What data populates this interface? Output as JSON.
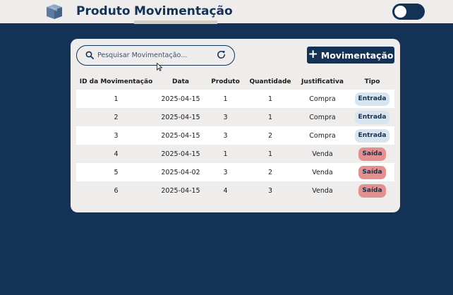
{
  "nav": {
    "items": [
      {
        "label": "Produto"
      },
      {
        "label": "Movimentação"
      }
    ],
    "active": "Movimentação"
  },
  "search": {
    "placeholder": "Pesquisar Movimentação...",
    "value": ""
  },
  "toolbar": {
    "add_label": "Movimentação",
    "add_icon": "plus-icon"
  },
  "table": {
    "columns": [
      "ID da Movimentação",
      "Data",
      "Produto",
      "Quantidade",
      "Justificativa",
      "Tipo"
    ],
    "rows": [
      {
        "id": "1",
        "data": "2025-04-15",
        "produto": "1",
        "quantidade": "1",
        "justificativa": "Compra",
        "tipo": "Entrada"
      },
      {
        "id": "2",
        "data": "2025-04-15",
        "produto": "3",
        "quantidade": "1",
        "justificativa": "Compra",
        "tipo": "Entrada"
      },
      {
        "id": "3",
        "data": "2025-04-15",
        "produto": "3",
        "quantidade": "2",
        "justificativa": "Compra",
        "tipo": "Entrada"
      },
      {
        "id": "4",
        "data": "2025-04-15",
        "produto": "1",
        "quantidade": "1",
        "justificativa": "Venda",
        "tipo": "Saída"
      },
      {
        "id": "5",
        "data": "2025-04-02",
        "produto": "3",
        "quantidade": "2",
        "justificativa": "Venda",
        "tipo": "Saída"
      },
      {
        "id": "6",
        "data": "2025-04-15",
        "produto": "4",
        "quantidade": "3",
        "justificativa": "Venda",
        "tipo": "Saída"
      }
    ]
  },
  "theme": {
    "dark_mode": false
  },
  "colors": {
    "background": "#143256",
    "primary": "#143256",
    "surface": "#efedec",
    "entrada_badge": "#d8e4ef",
    "saida_badge": "#e3918f"
  }
}
